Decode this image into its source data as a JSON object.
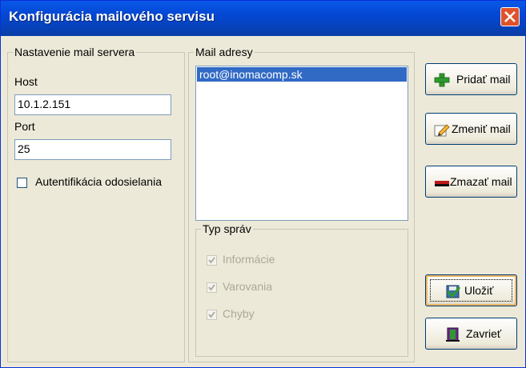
{
  "window": {
    "title": "Konfigurácia mailového servisu"
  },
  "mail_server": {
    "group_label": "Nastavenie mail servera",
    "host_label": "Host",
    "host_value": "10.1.2.151",
    "port_label": "Port",
    "port_value": "25",
    "auth_label": "Autentifikácia odosielania",
    "auth_checked": false
  },
  "mail_addresses": {
    "group_label": "Mail adresy",
    "items": [
      "root@inomacomp.sk"
    ],
    "selected_index": 0
  },
  "message_types": {
    "group_label": "Typ správ",
    "items": [
      {
        "label": "Informácie",
        "checked": true,
        "enabled": false
      },
      {
        "label": "Varovania",
        "checked": true,
        "enabled": false
      },
      {
        "label": "Chyby",
        "checked": true,
        "enabled": false
      }
    ]
  },
  "buttons": {
    "add": "Pridať mail",
    "edit": "Zmeniť mail",
    "delete": "Zmazať mail",
    "save": "Uložiť",
    "close": "Zavrieť"
  },
  "icons": {
    "close": "close-icon",
    "add": "plus-icon",
    "edit": "pencil-icon",
    "delete": "minus-icon",
    "save": "save-icon",
    "exit": "door-exit-icon"
  },
  "colors": {
    "titlebar": "#0347d4",
    "selection": "#316ac5",
    "close_button": "#e0522c"
  }
}
